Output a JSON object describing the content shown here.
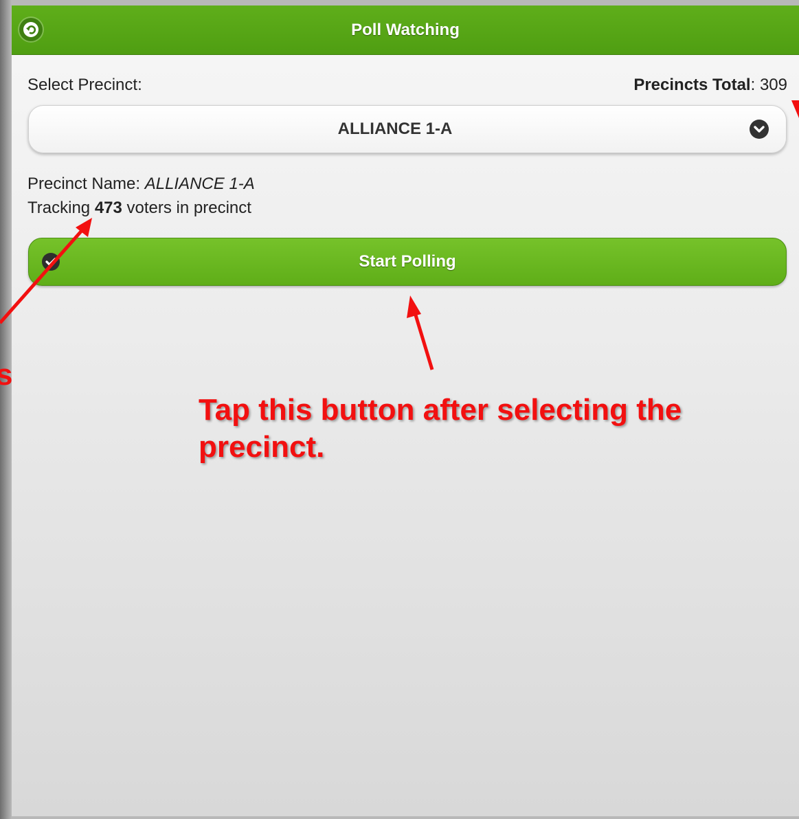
{
  "header": {
    "title": "Poll Watching",
    "back_icon": "back-arrow-icon",
    "color": "#56a515"
  },
  "form": {
    "select_label": "Select Precinct:",
    "precincts_total_label": "Precincts Total",
    "precincts_total_value": ": 309",
    "selected_precinct": "ALLIANCE 1-A",
    "dropdown_icon": "chevron-down-icon"
  },
  "info": {
    "precinct_name_label": "Precinct Name: ",
    "precinct_name_value": "ALLIANCE 1-A",
    "tracking_prefix": "Tracking ",
    "tracking_count": "473",
    "tracking_suffix": " voters in precinct"
  },
  "actions": {
    "start_label": "Start Polling",
    "start_icon": "check-icon",
    "accent_color": "#6bb821"
  },
  "annotations": {
    "tap_text": "Tap this button after selecting the precinct.",
    "partial_left_text": "s",
    "arrow_color": "#f21010"
  }
}
